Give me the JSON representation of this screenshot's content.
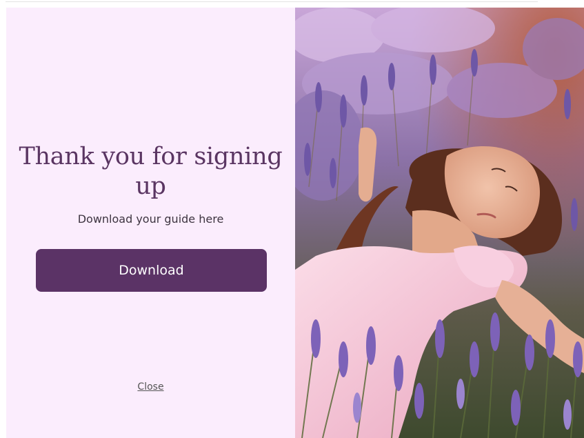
{
  "popup": {
    "headline": "Thank you for signing up",
    "subtext": "Download your guide here",
    "download_label": "Download",
    "close_label": "Close"
  },
  "image": {
    "alt": "Woman lying in a lavender field"
  },
  "colors": {
    "panel_background": "#fbedfd",
    "headline_color": "#5a3562",
    "text_color": "#3d3440",
    "button_background": "#5b3366",
    "button_text": "#ffffff",
    "close_color": "#555555"
  }
}
